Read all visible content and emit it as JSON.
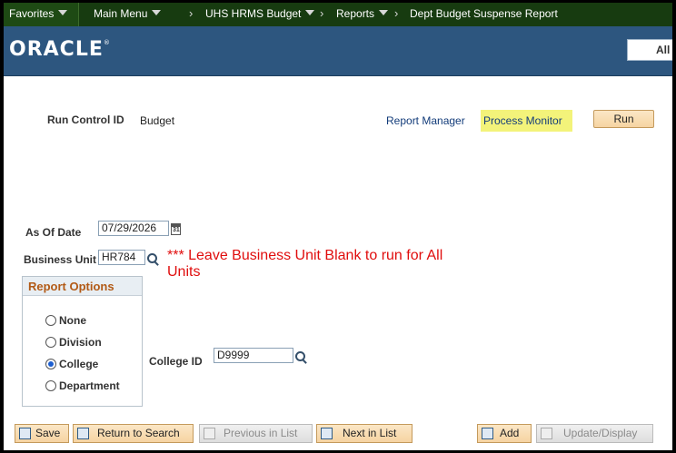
{
  "nav": {
    "favorites": "Favorites",
    "main_menu": "Main Menu",
    "sep": "›",
    "crumbs": [
      "UHS HRMS Budget",
      "Reports",
      "Dept Budget Suspense Report"
    ]
  },
  "banner": {
    "logo": "ORACLE",
    "logo_mark": "®",
    "search_partial": "All"
  },
  "run_control": {
    "label": "Run Control ID",
    "value": "Budget",
    "report_manager": "Report Manager",
    "process_monitor": "Process Monitor",
    "run_button": "Run"
  },
  "form": {
    "as_of_date_label": "As Of Date",
    "as_of_date_value": "07/29/2026",
    "calendar_glyph": "31",
    "business_unit_label": "Business Unit",
    "business_unit_value": "HR784",
    "warning": "*** Leave Business Unit Blank to run for All Units",
    "college_id_label": "College ID",
    "college_id_value": "D9999"
  },
  "report_options": {
    "title": "Report Options",
    "options": [
      {
        "label": "None",
        "selected": false
      },
      {
        "label": "Division",
        "selected": false
      },
      {
        "label": "College",
        "selected": true
      },
      {
        "label": "Department",
        "selected": false
      }
    ]
  },
  "toolbar": {
    "save": "Save",
    "return_to_search": "Return to Search",
    "previous_in_list": "Previous in List",
    "next_in_list": "Next in List",
    "add": "Add",
    "update_display": "Update/Display"
  },
  "colors": {
    "nav_bg": "#173b10",
    "banner_bg": "#2d567f",
    "highlight": "#f3f37a",
    "warning": "#e00d0d",
    "group_title": "#b25a16"
  }
}
